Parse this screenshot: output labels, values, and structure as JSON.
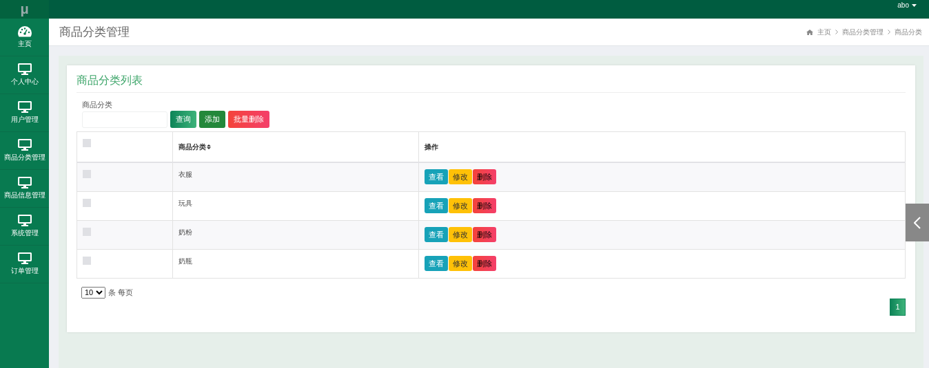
{
  "logo": "μ",
  "user": {
    "name": "abo"
  },
  "sidebar": {
    "items": [
      {
        "label": "主页"
      },
      {
        "label": "个人中心"
      },
      {
        "label": "用户管理"
      },
      {
        "label": "商品分类管理"
      },
      {
        "label": "商品信息管理"
      },
      {
        "label": "系统管理"
      },
      {
        "label": "订单管理"
      }
    ]
  },
  "page_title": "商品分类管理",
  "breadcrumb": [
    "主页",
    "商品分类管理",
    "商品分类"
  ],
  "card_title": "商品分类列表",
  "search": {
    "label": "商品分类"
  },
  "toolbar": [
    {
      "label": "查询",
      "kind": "query"
    },
    {
      "label": "添加",
      "kind": "add"
    },
    {
      "label": "批量删除",
      "kind": "delete"
    }
  ],
  "table": {
    "columns": [
      "商品分类",
      "操作"
    ],
    "header_checked": false,
    "rows": [
      {
        "checked": false,
        "name": "衣服",
        "actions": [
          {
            "label": "查看",
            "kind": "view"
          },
          {
            "label": "修改",
            "kind": "edit"
          },
          {
            "label": "删除",
            "kind": "delete"
          }
        ]
      },
      {
        "checked": false,
        "name": "玩具",
        "actions": [
          {
            "label": "查看",
            "kind": "view"
          },
          {
            "label": "修改",
            "kind": "edit"
          },
          {
            "label": "删除",
            "kind": "delete"
          }
        ]
      },
      {
        "checked": false,
        "name": "奶粉",
        "actions": [
          {
            "label": "查看",
            "kind": "view"
          },
          {
            "label": "修改",
            "kind": "edit"
          },
          {
            "label": "删除",
            "kind": "delete"
          }
        ]
      },
      {
        "checked": false,
        "name": "奶瓶",
        "actions": [
          {
            "label": "查看",
            "kind": "view"
          },
          {
            "label": "修改",
            "kind": "edit"
          },
          {
            "label": "删除",
            "kind": "delete"
          }
        ]
      }
    ]
  },
  "page_size": {
    "value": "10",
    "label": "条 每页"
  },
  "pagination": [
    {
      "label": "1",
      "selected": true
    }
  ]
}
